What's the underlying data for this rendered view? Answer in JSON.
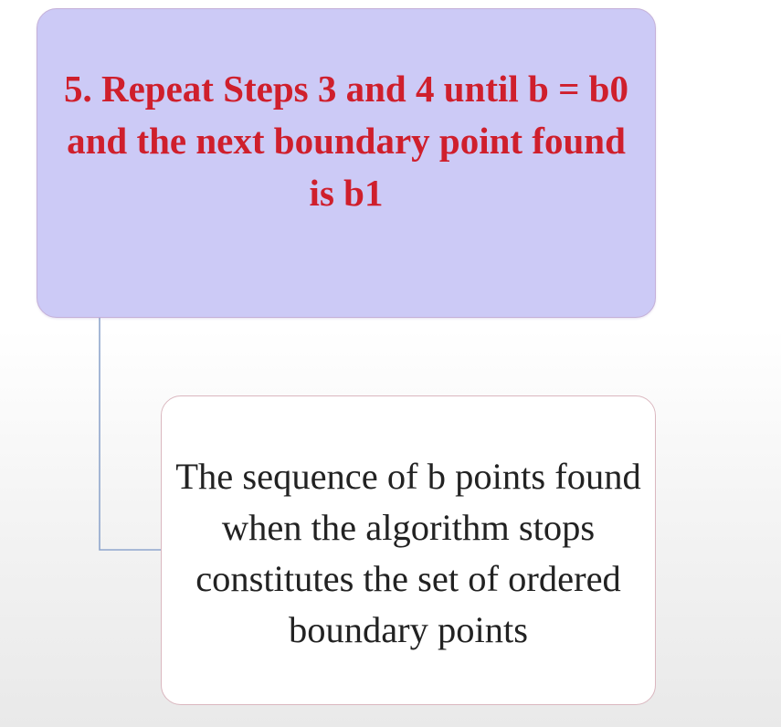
{
  "diagram": {
    "step_box": {
      "text": "5. Repeat Steps 3 and 4 until b = b0 and the next boundary point found is b1"
    },
    "result_box": {
      "text": "The sequence of b points found when the algorithm stops constitutes the set of ordered boundary points"
    }
  },
  "colors": {
    "step_box_fill": "#cccaf6",
    "step_text": "#cf1f2c",
    "result_box_fill": "#ffffff",
    "result_text": "#222222",
    "connector": "#8fa6cc"
  }
}
